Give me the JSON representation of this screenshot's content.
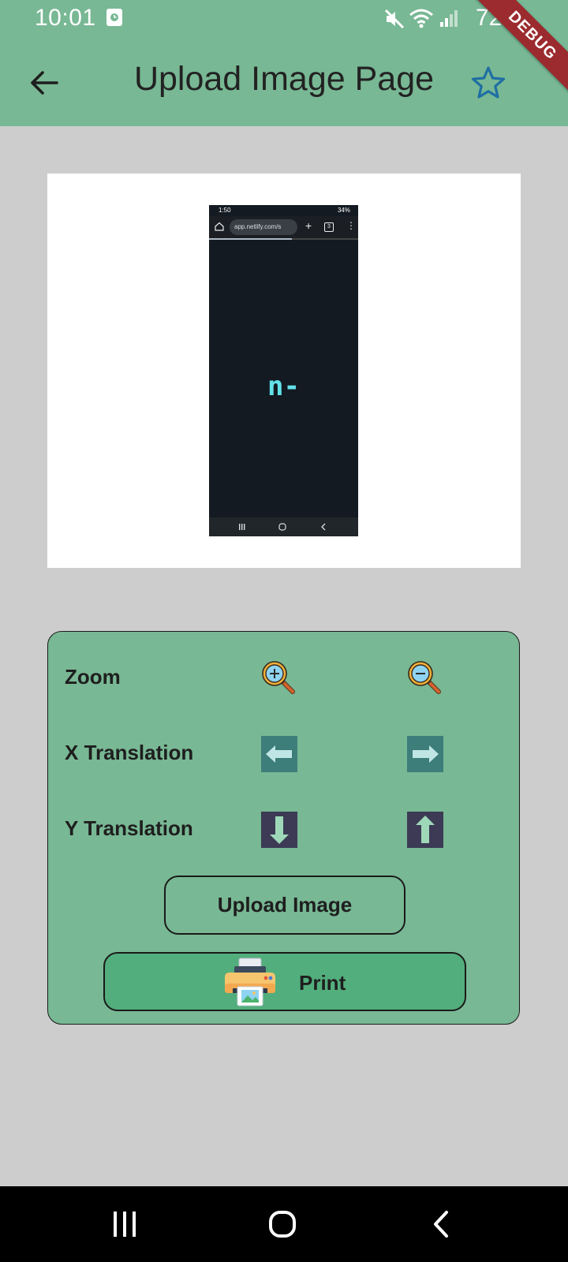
{
  "status_bar": {
    "time": "10:01",
    "battery": "72%"
  },
  "debug_banner": "DEBUG",
  "app_bar": {
    "title": "Upload Image Page"
  },
  "preview": {
    "status_time": "1:50",
    "status_battery": "34%",
    "url": "app.netlify.com/s",
    "tab_count": "3",
    "logo": "n-"
  },
  "controls": {
    "zoom_label": "Zoom",
    "x_translation_label": "X Translation",
    "y_translation_label": "Y Translation",
    "upload_label": "Upload Image",
    "print_label": "Print"
  },
  "icons": {
    "zoom_in": "zoom-in-icon",
    "zoom_out": "zoom-out-icon",
    "left": "arrow-left-icon",
    "right": "arrow-right-icon",
    "down": "arrow-down-icon",
    "up": "arrow-up-icon",
    "printer": "printer-icon"
  },
  "colors": {
    "app_bar": "#78b894",
    "background": "#cdcdcd",
    "panel": "#78b894",
    "print_button": "#52ae7c",
    "star": "#1f6fa3",
    "x_arrow_tile": "#3d7d7a",
    "y_arrow_tile": "#3c3a55"
  }
}
